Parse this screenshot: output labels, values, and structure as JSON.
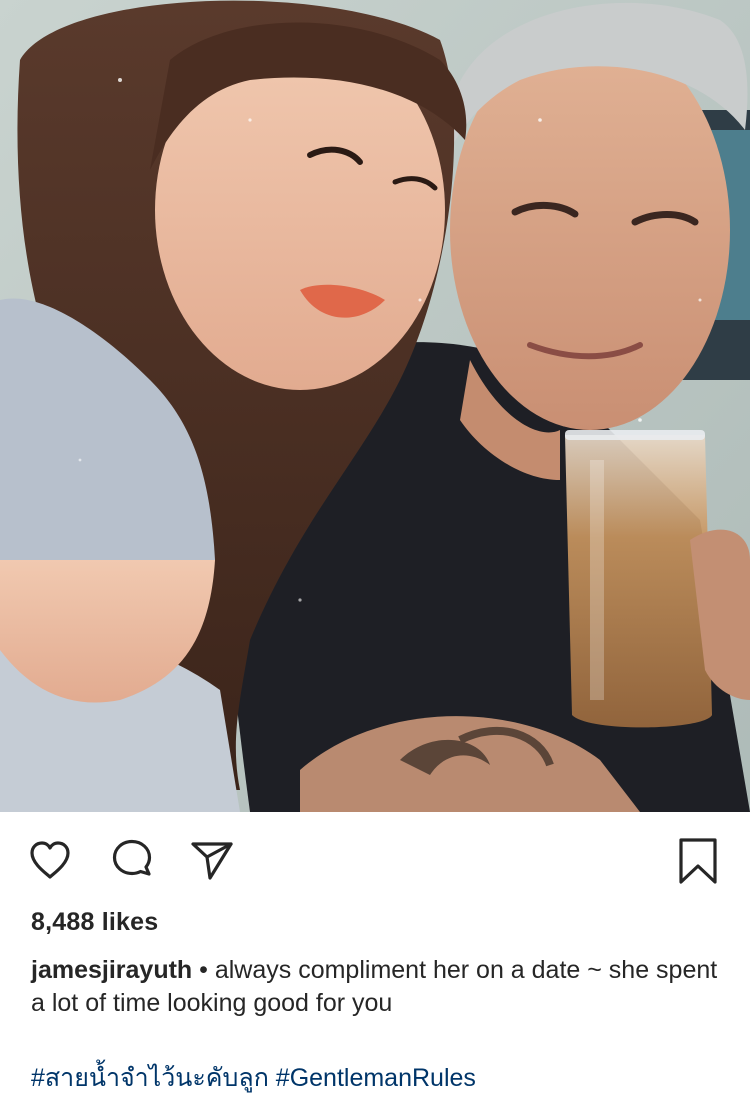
{
  "post": {
    "photo_icon": "photo-couple",
    "likes": "8,488 likes",
    "caption": {
      "username": "jamesjirayuth",
      "separator": " • ",
      "text": "always compliment her on a date ~ she spent a lot of time looking good for you"
    },
    "hashtags": [
      "#สายน้ำจำไว้นะคับลูก",
      "#GentlemanRules"
    ]
  },
  "actions": {
    "like_icon": "heart-icon",
    "comment_icon": "comment-icon",
    "share_icon": "paper-plane-icon",
    "save_icon": "bookmark-icon"
  },
  "colors": {
    "text": "#262626",
    "hashtag": "#003569",
    "background": "#ffffff"
  }
}
